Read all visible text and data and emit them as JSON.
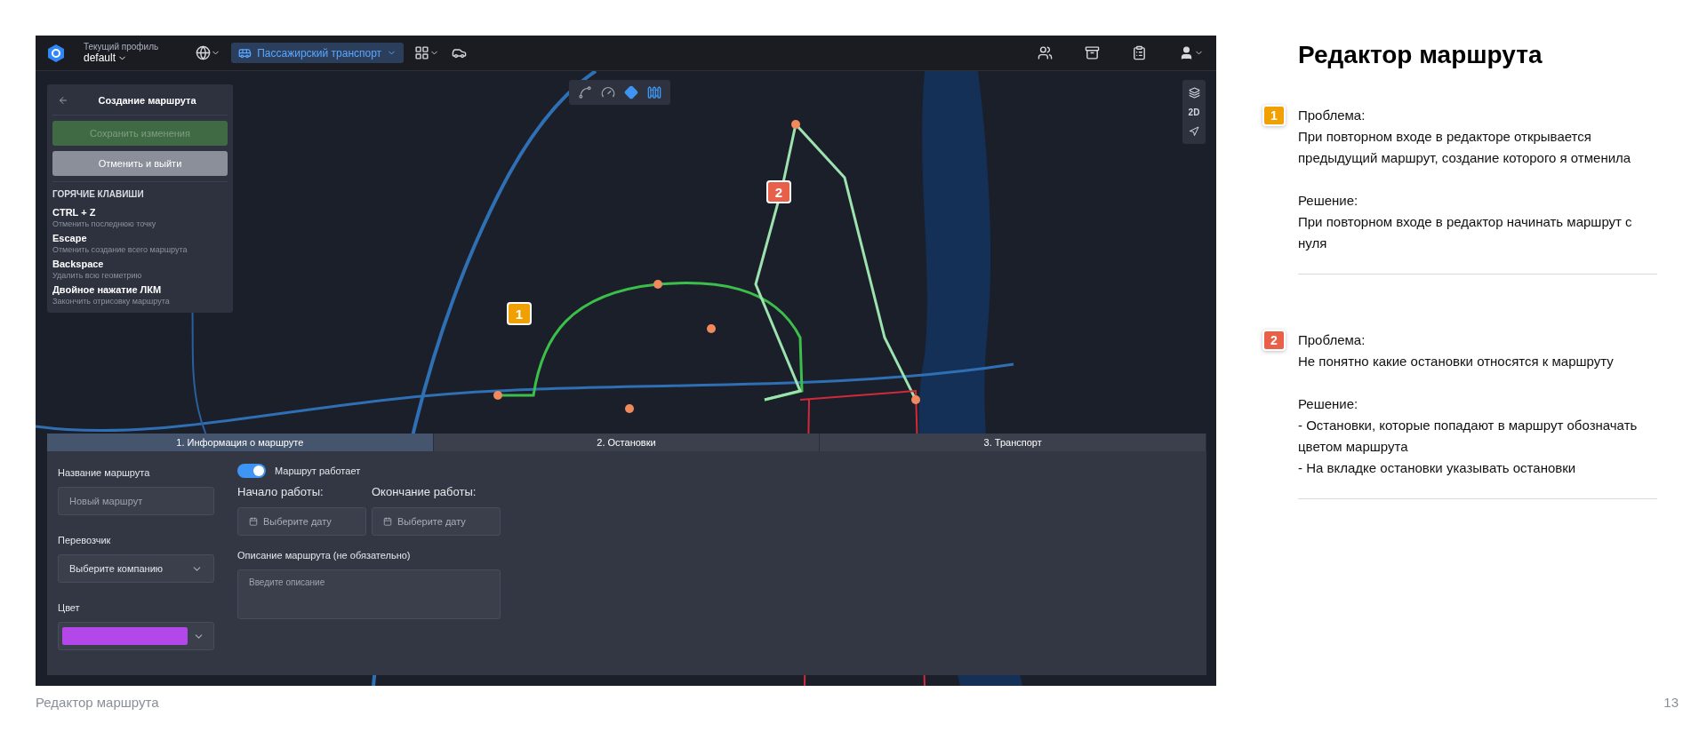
{
  "app": {
    "profile_label": "Текущий профиль",
    "profile_name": "default",
    "transport_button": "Пассажирский транспорт",
    "panel": {
      "title": "Создание маршрута",
      "buttons": [
        {
          "label": "Сохранить изменения",
          "kind": "save",
          "disabled": true
        },
        {
          "label": "Отменить и выйти",
          "kind": "cancel",
          "disabled": false
        }
      ],
      "hotkeys_title": "ГОРЯЧИЕ КЛАВИШИ",
      "hotkeys": [
        {
          "key": "CTRL + Z",
          "description": "Отменить последнюю точку"
        },
        {
          "key": "Escape",
          "description": "Отменить создание всего маршрута"
        },
        {
          "key": "Backspace",
          "description": "Удалить всю геометрию"
        },
        {
          "key": "Двойное нажатие ЛКМ",
          "description": "Закончить отрисовку маршрута"
        }
      ]
    },
    "map_mode": "2D",
    "markers": [
      {
        "label": "1",
        "color": "#f0a000"
      },
      {
        "label": "2",
        "color": "#e8604a"
      }
    ],
    "form": {
      "tabs": [
        {
          "label": "1. Информация о маршруте",
          "selected": true
        },
        {
          "label": "2. Остановки",
          "selected": false
        },
        {
          "label": "3. Транспорт",
          "selected": false
        }
      ],
      "name_label": "Название маршрута",
      "name_placeholder": "Новый маршрут",
      "carrier_label": "Перевозчик",
      "carrier_value": "Выберите компанию",
      "color_field": {
        "label": "Цвет",
        "color": "#b347ea"
      },
      "toggle": {
        "label": "Маршрут работает",
        "on": true
      },
      "start_label": "Начало работы:",
      "end_label": "Окончание работы:",
      "date_placeholder_start": "Выберите дату",
      "date_placeholder_end": "Выберите дату",
      "description_label": "Описание маршрута (не обязательно)",
      "description_placeholder": "Введите описание"
    }
  },
  "notes_title": "Редактор маршрута",
  "notes": [
    {
      "number": "1",
      "color": "#f0a000",
      "problem_label": "Проблема:",
      "problem": "При повторном входе в редакторе открывается предыдущий маршрут, создание которого я отменила",
      "solution_label": "Решение:",
      "solution": [
        "При повторном входе в редактор начинать маршрут с нуля"
      ]
    },
    {
      "number": "2",
      "color": "#e8604a",
      "problem_label": "Проблема:",
      "problem": "Не понятно какие остановки относятся к маршруту",
      "solution_label": "Решение:",
      "solution": [
        "- Остановки, которые попадают в маршрут обозначать цветом маршрута",
        "- На вкладке остановки указывать остановки"
      ]
    }
  ],
  "footer_title": "Редактор маршрута",
  "page_number": "13"
}
